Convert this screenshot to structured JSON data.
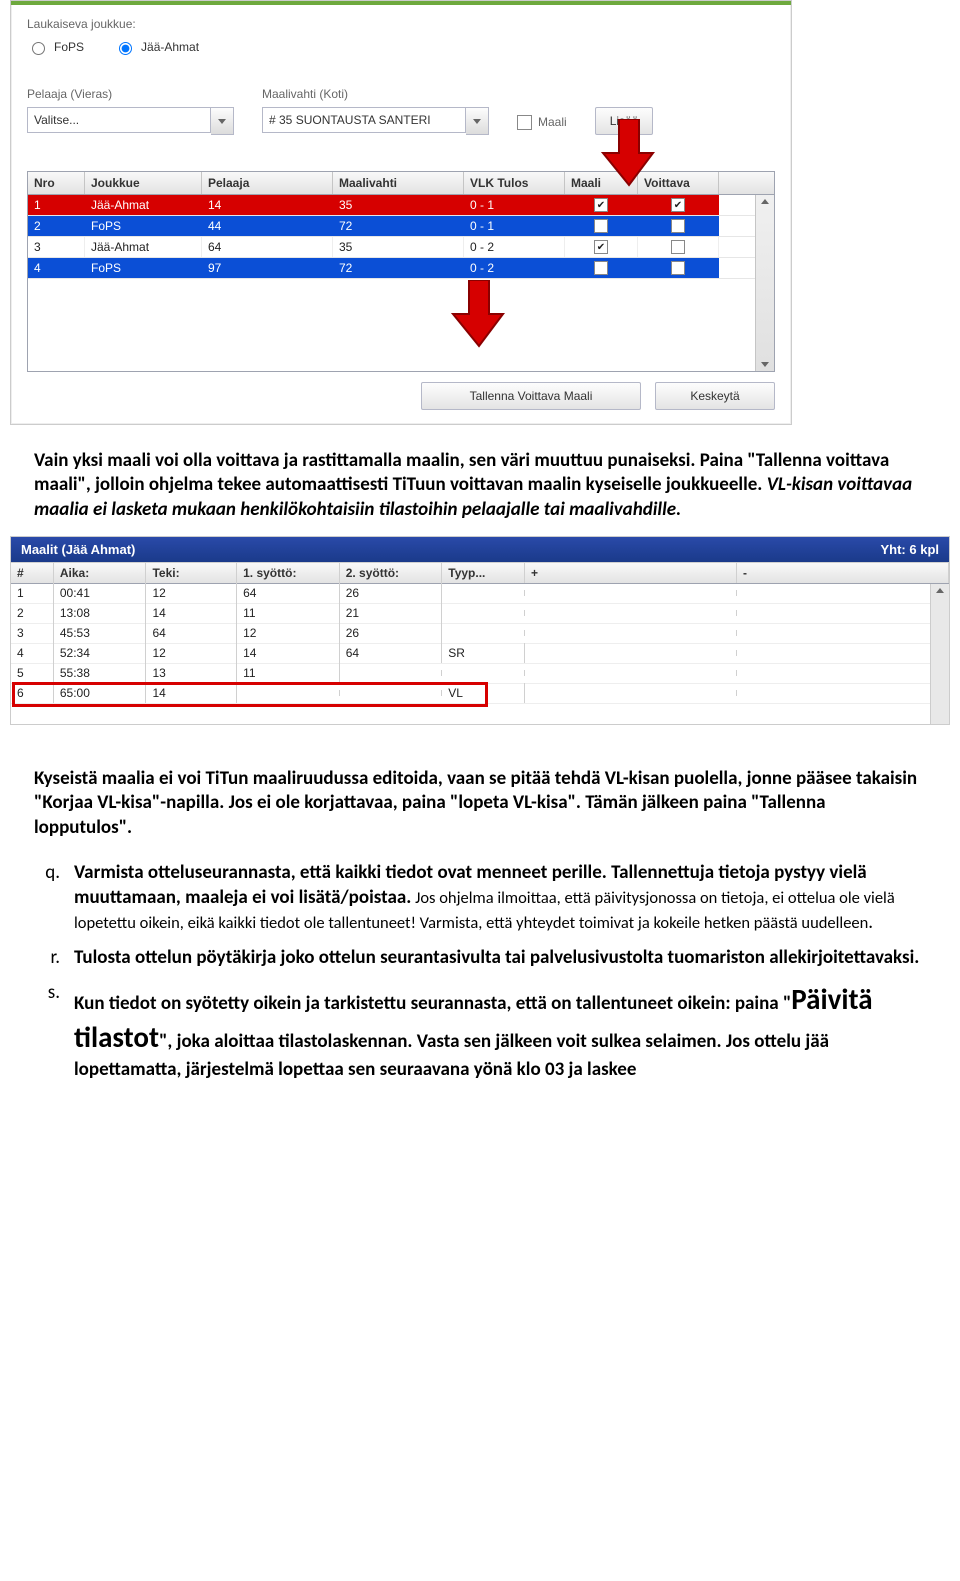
{
  "shot1": {
    "form": {
      "shootingTeamLabel": "Laukaiseva joukkue:",
      "radioFoPS": "FoPS",
      "radioJaa": "Jää-Ahmat",
      "playerGuestLabel": "Pelaaja (Vieras)",
      "goalieHomeLabel": "Maalivahti (Koti)",
      "playerGuestValue": "Valitse...",
      "goalieHomeValue": "# 35 SUONTAUSTA SANTERI",
      "goalCheckboxLabel": "Maali",
      "addButton": "Lisää"
    },
    "grid": {
      "headers": {
        "nro": "Nro",
        "joukkue": "Joukkue",
        "pelaaja": "Pelaaja",
        "maalivahti": "Maalivahti",
        "tulos": "VLK Tulos",
        "maali": "Maali",
        "voittava": "Voittava"
      },
      "rows": [
        {
          "nro": "1",
          "joukkue": "Jää-Ahmat",
          "pelaaja": "14",
          "maalivahti": "35",
          "tulos": "0 - 1",
          "maali": true,
          "voittava": true,
          "cls": "red"
        },
        {
          "nro": "2",
          "joukkue": "FoPS",
          "pelaaja": "44",
          "maalivahti": "72",
          "tulos": "0 - 1",
          "maali": false,
          "voittava": false,
          "cls": "blue"
        },
        {
          "nro": "3",
          "joukkue": "Jää-Ahmat",
          "pelaaja": "64",
          "maalivahti": "35",
          "tulos": "0 - 2",
          "maali": true,
          "voittava": false,
          "cls": ""
        },
        {
          "nro": "4",
          "joukkue": "FoPS",
          "pelaaja": "97",
          "maalivahti": "72",
          "tulos": "0 - 2",
          "maali": false,
          "voittava": false,
          "cls": "blue"
        }
      ]
    },
    "buttons": {
      "save": "Tallenna Voittava Maali",
      "cancel": "Keskeytä"
    }
  },
  "para1": {
    "t1": "Vain yksi maali voi olla voittava ja rastittamalla maalin, sen väri muuttuu punaiseksi. Paina \"Tallenna voittava maali\", jolloin ohjelma tekee automaattisesti TiTuun voittavan maalin kyseiselle joukkueelle. ",
    "t2": "VL-kisan voittavaa maalia ei lasketa mukaan henkilökohtaisiin tilastoihin pelaajalle tai maalivahdille."
  },
  "shot2": {
    "title": "Maalit (Jää Ahmat)",
    "total": "Yht: 6 kpl",
    "headers": {
      "n": "#",
      "aika": "Aika:",
      "teki": "Teki:",
      "s1": "1. syöttö:",
      "s2": "2. syöttö:",
      "tyyp": "Tyyp...",
      "plus": "+",
      "minus": "-"
    },
    "rows": [
      {
        "n": "1",
        "aika": "00:41",
        "teki": "12",
        "s1": "64",
        "s2": "26",
        "ty": "",
        "p": "",
        "m": ""
      },
      {
        "n": "2",
        "aika": "13:08",
        "teki": "14",
        "s1": "11",
        "s2": "21",
        "ty": "",
        "p": "",
        "m": ""
      },
      {
        "n": "3",
        "aika": "45:53",
        "teki": "64",
        "s1": "12",
        "s2": "26",
        "ty": "",
        "p": "",
        "m": ""
      },
      {
        "n": "4",
        "aika": "52:34",
        "teki": "12",
        "s1": "14",
        "s2": "64",
        "ty": "SR",
        "p": "",
        "m": ""
      },
      {
        "n": "5",
        "aika": "55:38",
        "teki": "13",
        "s1": "11",
        "s2": "",
        "ty": "",
        "p": "",
        "m": ""
      },
      {
        "n": "6",
        "aika": "65:00",
        "teki": "14",
        "s1": "",
        "s2": "",
        "ty": "VL",
        "p": "",
        "m": ""
      }
    ]
  },
  "para2": {
    "t": "Kyseistä maalia ei voi TiTun maaliruudussa editoida, vaan se pitää tehdä VL-kisan puolella, jonne pääsee takaisin \"Korjaa VL-kisa\"-napilla. Jos ei ole korjattavaa, paina \"lopeta VL-kisa\". Tämän jälkeen paina \"Tallenna lopputulos\"."
  },
  "list": {
    "q": {
      "m": "q.",
      "b": "Varmista otteluseurannasta, että kaikki tiedot ovat menneet perille. Tallennettuja tietoja pystyy vielä muuttamaan, maaleja ei voi lisätä/poistaa.",
      "rest1": " Jos ohjelma ilmoittaa, että päivitysjonossa on tietoja, ei ottelua ole vielä lopetettu oikein, eikä kaikki tiedot ole tallentuneet! Varmista, että yhteydet toimivat ja kokeile hetken päästä uudelleen",
      "rest2": "."
    },
    "r": {
      "m": "r.",
      "t": "Tulosta ottelun pöytäkirja joko ottelun seurantasivulta tai palvelusivustolta tuomariston allekirjoitettavaksi."
    },
    "s": {
      "m": "s.",
      "t1": "Kun tiedot on syötetty oikein ja tarkistettu seurannasta, että on tallentuneet oikein: paina \"",
      "big": "Päivitä tilastot",
      "t2": "\", joka aloittaa tilastolaskennan.   Vasta sen jälkeen voit sulkea selaimen.  Jos ottelu jää lopettamatta, järjestelmä lopettaa sen seuraavana yönä klo 03 ja laskee"
    }
  }
}
